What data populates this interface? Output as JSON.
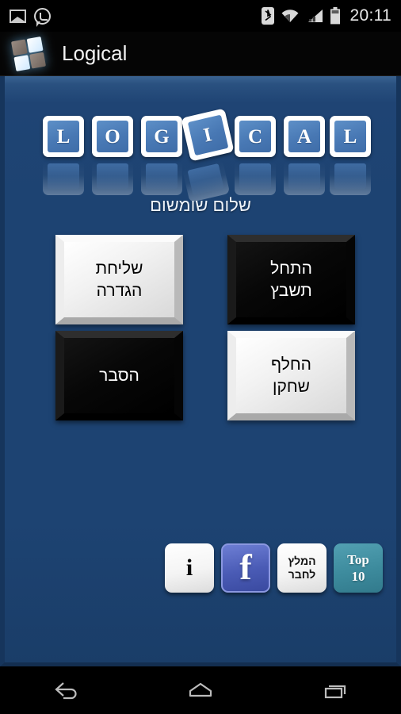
{
  "status_bar": {
    "time": "20:11",
    "left_icons": [
      "gallery-icon",
      "whatsapp-icon"
    ],
    "right_icons": [
      "bluetooth-icon",
      "wifi-icon",
      "signal-icon",
      "battery-icon"
    ]
  },
  "action_bar": {
    "app_icon": "logical-app-icon",
    "title": "Logical"
  },
  "logo": {
    "tiles": [
      {
        "letter": "L",
        "rotated": false
      },
      {
        "letter": "O",
        "rotated": false
      },
      {
        "letter": "G",
        "rotated": false
      },
      {
        "letter": "I",
        "rotated": true
      },
      {
        "letter": "C",
        "rotated": false
      },
      {
        "letter": "A",
        "rotated": false
      },
      {
        "letter": "L",
        "rotated": false
      }
    ]
  },
  "greeting": "שלום שומשום",
  "main_buttons": [
    {
      "id": "send-config",
      "line1": "שליחת",
      "line2": "הגדרה",
      "style": "light"
    },
    {
      "id": "start-crossword",
      "line1": "התחל",
      "line2": "תשבץ",
      "style": "dark"
    },
    {
      "id": "explain",
      "line1": "הסבר",
      "line2": "",
      "style": "dark"
    },
    {
      "id": "switch-player",
      "line1": "החלף",
      "line2": "שחקן",
      "style": "light"
    }
  ],
  "bottom_buttons": [
    {
      "id": "info",
      "glyph": "i",
      "style": "info"
    },
    {
      "id": "facebook",
      "glyph": "f",
      "style": "fb"
    },
    {
      "id": "recommend",
      "line1": "המלץ",
      "line2": "לחבר",
      "style": "white"
    },
    {
      "id": "top10",
      "line1": "Top",
      "line2": "10",
      "style": "teal"
    }
  ],
  "nav_bar": {
    "back": "back-icon",
    "home": "home-icon",
    "recents": "recents-icon"
  },
  "colors": {
    "background_navy": "#1d4372",
    "tile_blue": "#4878b4",
    "teal": "#3d8b9d",
    "facebook_blue": "#4a5bb5",
    "border_dark": "#16355c"
  }
}
